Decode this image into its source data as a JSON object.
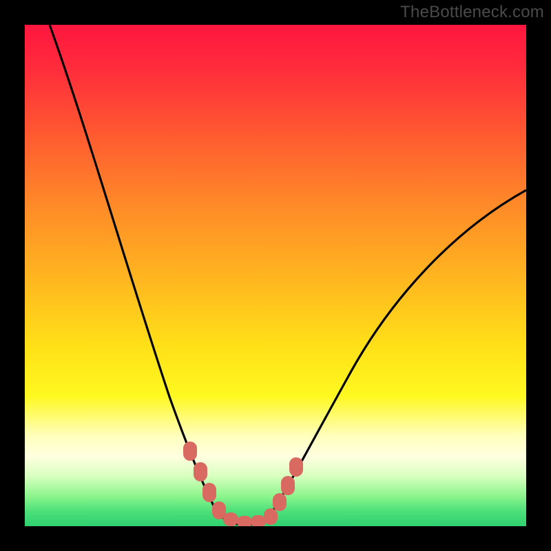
{
  "watermark": "TheBottleneck.com",
  "colors": {
    "background": "#000000",
    "gradient_top": "#ff163f",
    "gradient_mid": "#ffe018",
    "gradient_bottom": "#30d070",
    "curve": "#000000",
    "marker": "#d86a62"
  },
  "chart_data": {
    "type": "line",
    "title": "",
    "xlabel": "",
    "ylabel": "",
    "xlim": [
      0,
      100
    ],
    "ylim": [
      0,
      100
    ],
    "series": [
      {
        "name": "bottleneck-curve",
        "x": [
          5,
          10,
          15,
          20,
          25,
          28,
          30,
          33,
          35,
          38,
          40,
          42,
          45,
          48,
          50,
          55,
          60,
          65,
          70,
          75,
          80,
          85,
          90,
          95,
          100
        ],
        "y": [
          100,
          85,
          70,
          55,
          40,
          30,
          22,
          12,
          6,
          2,
          0,
          0,
          0,
          2,
          5,
          12,
          20,
          27,
          33,
          39,
          44,
          49,
          53,
          57,
          60
        ]
      }
    ],
    "markers": {
      "name": "highlighted-points",
      "x": [
        32,
        34,
        36,
        38,
        40,
        42,
        44,
        46,
        48,
        50,
        51
      ],
      "y": [
        14,
        8,
        4,
        2,
        0,
        0,
        0,
        1,
        2,
        5,
        7
      ]
    },
    "annotations": []
  }
}
